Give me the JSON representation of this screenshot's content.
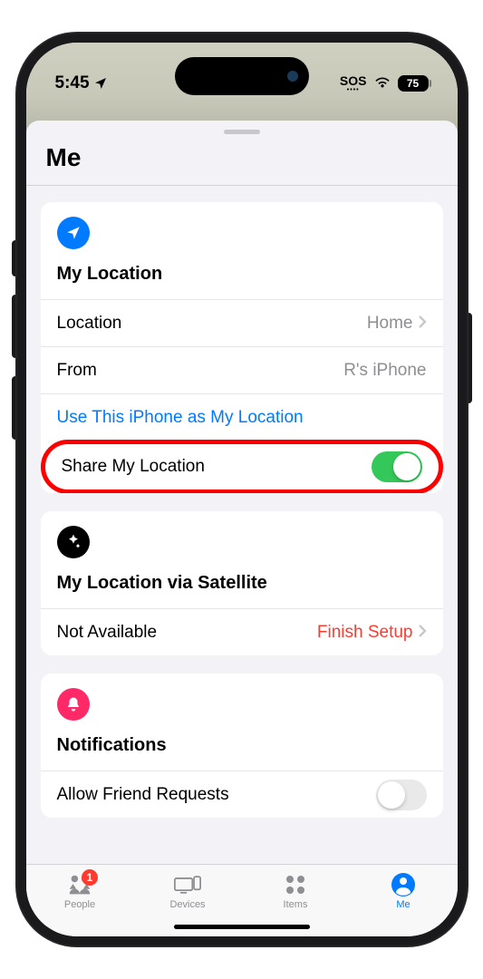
{
  "status": {
    "time": "5:45",
    "sos": "SOS",
    "battery": "75"
  },
  "sheet": {
    "title": "Me"
  },
  "location_card": {
    "heading": "My Location",
    "location_label": "Location",
    "location_value": "Home",
    "from_label": "From",
    "from_value": "R's iPhone",
    "use_this_iphone": "Use This iPhone as My Location",
    "share_label": "Share My Location",
    "share_on": true
  },
  "satellite_card": {
    "heading": "My Location via Satellite",
    "status_label": "Not Available",
    "action": "Finish Setup"
  },
  "notifications_card": {
    "heading": "Notifications",
    "allow_label": "Allow Friend Requests",
    "allow_on": false
  },
  "tabs": {
    "people": "People",
    "people_badge": "1",
    "devices": "Devices",
    "items": "Items",
    "me": "Me"
  }
}
